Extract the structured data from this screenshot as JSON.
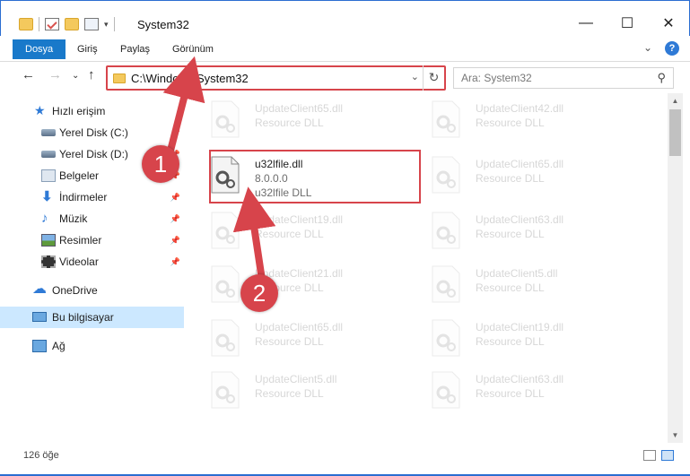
{
  "window": {
    "title": "System32",
    "minimize_glyph": "—",
    "maximize_glyph": "☐",
    "close_glyph": "✕"
  },
  "ribbon": {
    "tabs": [
      "Dosya",
      "Giriş",
      "Paylaş",
      "Görünüm"
    ],
    "active_tab": "Dosya",
    "expand_glyph": "⌄"
  },
  "nav_buttons": {
    "back": "←",
    "forward": "→",
    "recent": "⌄",
    "up": "↑"
  },
  "address": {
    "path": "C:\\Windows\\System32",
    "dropdown_glyph": "⌄",
    "refresh_glyph": "↻"
  },
  "search": {
    "placeholder": "Ara: System32",
    "icon_glyph": "⚲"
  },
  "sidebar": {
    "items": [
      {
        "label": "Hızlı erişim",
        "icon": "star-icon",
        "pinned": false
      },
      {
        "label": "Yerel Disk (C:)",
        "icon": "drive-icon",
        "pinned": true
      },
      {
        "label": "Yerel Disk (D:)",
        "icon": "drive-icon",
        "pinned": true
      },
      {
        "label": "Belgeler",
        "icon": "documents-icon",
        "pinned": true
      },
      {
        "label": "İndirmeler",
        "icon": "downloads-icon",
        "pinned": true
      },
      {
        "label": "Müzik",
        "icon": "music-icon",
        "pinned": true
      },
      {
        "label": "Resimler",
        "icon": "pictures-icon",
        "pinned": true
      },
      {
        "label": "Videolar",
        "icon": "videos-icon",
        "pinned": true
      },
      {
        "label": "OneDrive",
        "icon": "onedrive-icon",
        "pinned": false
      },
      {
        "label": "Bu bilgisayar",
        "icon": "this-pc-icon",
        "pinned": false,
        "selected": true
      },
      {
        "label": "Ağ",
        "icon": "network-icon",
        "pinned": false
      }
    ],
    "pin_glyph": "📌"
  },
  "files": {
    "left_column": [
      {
        "name": "UpdateClient65.dll",
        "type": "Resource DLL"
      },
      {
        "name": "u32lfile.dll",
        "type": "8.0.0.0",
        "description": "u32lfile DLL",
        "highlighted": true
      },
      {
        "name": "UpdateClient19.dll",
        "type": "Resource DLL"
      },
      {
        "name": "UpdateClient21.dll",
        "type": "Resource DLL"
      },
      {
        "name": "UpdateClient65.dll",
        "type": "Resource DLL"
      },
      {
        "name": "UpdateClient5.dll",
        "type": "Resource DLL"
      }
    ],
    "right_column": [
      {
        "name": "UpdateClient42.dll",
        "type": "Resource DLL"
      },
      {
        "name": "UpdateClient65.dll",
        "type": "Resource DLL"
      },
      {
        "name": "UpdateClient63.dll",
        "type": "Resource DLL"
      },
      {
        "name": "UpdateClient5.dll",
        "type": "Resource DLL"
      },
      {
        "name": "UpdateClient19.dll",
        "type": "Resource DLL"
      },
      {
        "name": "UpdateClient63.dll",
        "type": "Resource DLL"
      }
    ]
  },
  "status": {
    "item_count": "126 öğe"
  },
  "annotations": {
    "step1": "1",
    "step2": "2",
    "color": "#d7444b"
  }
}
